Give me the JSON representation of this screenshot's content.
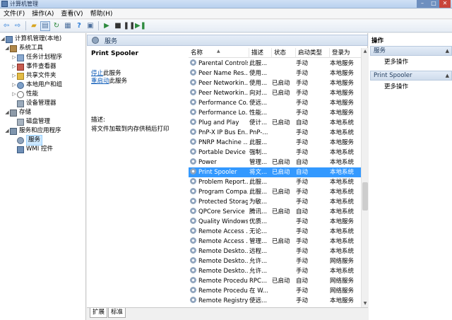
{
  "window": {
    "title": "计算机管理"
  },
  "menu": [
    {
      "label": "文件(F)",
      "name": "menu-file"
    },
    {
      "label": "操作(A)",
      "name": "menu-action"
    },
    {
      "label": "查看(V)",
      "name": "menu-view"
    },
    {
      "label": "帮助(H)",
      "name": "menu-help"
    }
  ],
  "toolbar": {
    "icons": [
      "back-arrow-icon",
      "forward-arrow-icon",
      "up-folder-icon",
      "console-tree-icon",
      "refresh-icon",
      "export-list-icon",
      "help-icon",
      "properties-icon",
      "play-icon",
      "stop-icon",
      "pause-icon",
      "resume-icon"
    ]
  },
  "tree": [
    {
      "label": "计算机管理(本地)",
      "level": 0,
      "exp": "◢",
      "icon": "computer-icon",
      "selected": false
    },
    {
      "label": "系统工具",
      "level": 1,
      "exp": "◢",
      "icon": "tools-icon",
      "selected": false
    },
    {
      "label": "任务计划程序",
      "level": 2,
      "exp": "▷",
      "icon": "task-scheduler-icon",
      "selected": false
    },
    {
      "label": "事件查看器",
      "level": 2,
      "exp": "▷",
      "icon": "event-viewer-icon",
      "selected": false
    },
    {
      "label": "共享文件夹",
      "level": 2,
      "exp": "▷",
      "icon": "shared-folder-icon",
      "selected": false
    },
    {
      "label": "本地用户和组",
      "level": 2,
      "exp": "▷",
      "icon": "users-icon",
      "selected": false
    },
    {
      "label": "性能",
      "level": 2,
      "exp": "▷",
      "icon": "performance-icon",
      "selected": false
    },
    {
      "label": "设备管理器",
      "level": 2,
      "exp": "",
      "icon": "device-manager-icon",
      "selected": false
    },
    {
      "label": "存储",
      "level": 1,
      "exp": "◢",
      "icon": "storage-icon",
      "selected": false
    },
    {
      "label": "磁盘管理",
      "level": 2,
      "exp": "",
      "icon": "disk-icon",
      "selected": false
    },
    {
      "label": "服务和应用程序",
      "level": 1,
      "exp": "◢",
      "icon": "services-apps-icon",
      "selected": false
    },
    {
      "label": "服务",
      "level": 2,
      "exp": "",
      "icon": "services-icon",
      "selected": true
    },
    {
      "label": "WMI 控件",
      "level": 2,
      "exp": "",
      "icon": "wmi-icon",
      "selected": false
    }
  ],
  "header": {
    "title": "服务"
  },
  "detail": {
    "service_name": "Print Spooler",
    "stop_link": "停止",
    "stop_suffix": "此服务",
    "restart_link": "重启动",
    "restart_suffix": "此服务",
    "desc_label": "描述:",
    "desc_text": "将文件加载到内存供稍后打印"
  },
  "columns": [
    "名称",
    "描述",
    "状态",
    "启动类型",
    "登录为"
  ],
  "services": [
    {
      "name": "Parental Controls",
      "desc": "此服...",
      "status": "",
      "start": "手动",
      "logon": "本地服务"
    },
    {
      "name": "Peer Name Res...",
      "desc": "使用...",
      "status": "",
      "start": "手动",
      "logon": "本地服务"
    },
    {
      "name": "Peer Networkin...",
      "desc": "使用...",
      "status": "已启动",
      "start": "手动",
      "logon": "本地服务"
    },
    {
      "name": "Peer Networkin...",
      "desc": "向对...",
      "status": "已启动",
      "start": "手动",
      "logon": "本地服务"
    },
    {
      "name": "Performance Co...",
      "desc": "使远...",
      "status": "",
      "start": "手动",
      "logon": "本地服务"
    },
    {
      "name": "Performance Lo...",
      "desc": "性能...",
      "status": "",
      "start": "手动",
      "logon": "本地服务"
    },
    {
      "name": "Plug and Play",
      "desc": "使计...",
      "status": "已启动",
      "start": "自动",
      "logon": "本地系统"
    },
    {
      "name": "PnP-X IP Bus En...",
      "desc": "PnP-...",
      "status": "",
      "start": "手动",
      "logon": "本地系统"
    },
    {
      "name": "PNRP Machine ...",
      "desc": "此服...",
      "status": "",
      "start": "手动",
      "logon": "本地服务"
    },
    {
      "name": "Portable Device ...",
      "desc": "强制...",
      "status": "",
      "start": "手动",
      "logon": "本地系统"
    },
    {
      "name": "Power",
      "desc": "管理...",
      "status": "已启动",
      "start": "自动",
      "logon": "本地系统"
    },
    {
      "name": "Print Spooler",
      "desc": "将文...",
      "status": "已启动",
      "start": "自动",
      "logon": "本地系统",
      "selected": true
    },
    {
      "name": "Problem Report...",
      "desc": "此服...",
      "status": "",
      "start": "手动",
      "logon": "本地系统"
    },
    {
      "name": "Program Compa...",
      "desc": "此服...",
      "status": "已启动",
      "start": "手动",
      "logon": "本地系统"
    },
    {
      "name": "Protected Storage",
      "desc": "为敏...",
      "status": "",
      "start": "手动",
      "logon": "本地系统"
    },
    {
      "name": "QPCore Service",
      "desc": "腾讯...",
      "status": "已启动",
      "start": "自动",
      "logon": "本地系统"
    },
    {
      "name": "Quality Windows...",
      "desc": "优质...",
      "status": "",
      "start": "手动",
      "logon": "本地服务"
    },
    {
      "name": "Remote Access ...",
      "desc": "无论...",
      "status": "",
      "start": "手动",
      "logon": "本地系统"
    },
    {
      "name": "Remote Access ...",
      "desc": "管理...",
      "status": "已启动",
      "start": "手动",
      "logon": "本地系统"
    },
    {
      "name": "Remote Deskto...",
      "desc": "远程...",
      "status": "",
      "start": "手动",
      "logon": "本地系统"
    },
    {
      "name": "Remote Deskto...",
      "desc": "允许...",
      "status": "",
      "start": "手动",
      "logon": "网络服务"
    },
    {
      "name": "Remote Deskto...",
      "desc": "允许...",
      "status": "",
      "start": "手动",
      "logon": "本地系统"
    },
    {
      "name": "Remote Procedu...",
      "desc": "RPC...",
      "status": "已启动",
      "start": "自动",
      "logon": "网络服务"
    },
    {
      "name": "Remote Procedu...",
      "desc": "在 W...",
      "status": "",
      "start": "手动",
      "logon": "网络服务"
    },
    {
      "name": "Remote Registry",
      "desc": "使远...",
      "status": "",
      "start": "手动",
      "logon": "本地服务"
    }
  ],
  "tabs": [
    "扩展",
    "标准"
  ],
  "actions": {
    "title": "操作",
    "sections": [
      {
        "label": "服务",
        "item": "更多操作"
      },
      {
        "label": "Print Spooler",
        "item": "更多操作"
      }
    ]
  },
  "colors": {
    "selection": "#3399ff",
    "link": "#0f5cb8",
    "header_bg": "#d3dfee"
  }
}
